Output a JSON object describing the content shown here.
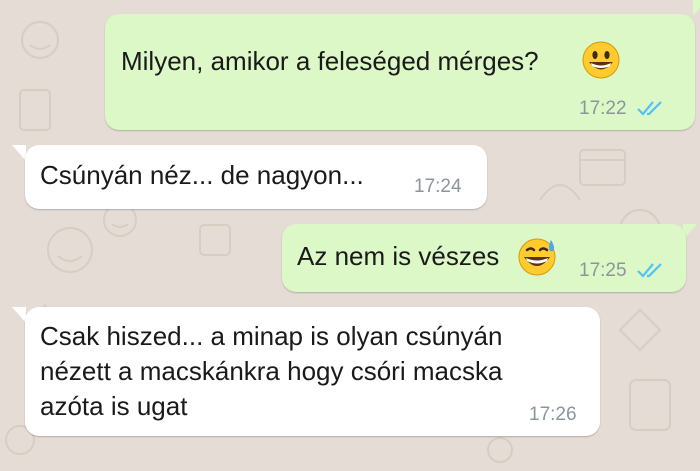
{
  "chat": {
    "messages": [
      {
        "direction": "outgoing",
        "text": "Milyen, amikor a feleséged mérges?",
        "emoji": "grinning-face",
        "time": "17:22",
        "status": "read"
      },
      {
        "direction": "incoming",
        "text": "Csúnyán néz... de nagyon...",
        "time": "17:24"
      },
      {
        "direction": "outgoing",
        "text": "Az nem is vészes",
        "emoji": "grinning-face-with-sweat",
        "time": "17:25",
        "status": "read"
      },
      {
        "direction": "incoming",
        "lines": [
          "Csak hiszed... a minap is olyan csúnyán",
          "nézett a macskánkra hogy csóri macska",
          "azóta is ugat"
        ],
        "time": "17:26"
      }
    ]
  },
  "colors": {
    "background": "#e5ddd5",
    "outgoing_bubble": "#dcf8c6",
    "incoming_bubble": "#ffffff",
    "read_ticks": "#4fc3f7",
    "timestamp": "#8a959c"
  }
}
